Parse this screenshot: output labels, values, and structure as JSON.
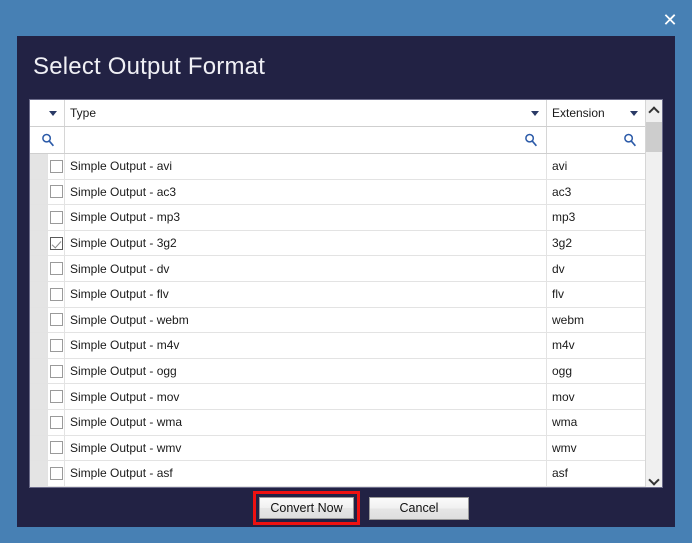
{
  "window": {
    "close_icon": "close-icon",
    "frame_color": "#4780b4",
    "dialog_color": "#222244"
  },
  "dialog": {
    "title": "Select Output Format"
  },
  "grid": {
    "columns": [
      {
        "key": "check",
        "label": "",
        "has_filter_arrow": true,
        "has_search": true
      },
      {
        "key": "type",
        "label": "Type",
        "has_filter_arrow": true,
        "has_search": true
      },
      {
        "key": "ext",
        "label": "Extension",
        "has_filter_arrow": true,
        "has_search": true
      }
    ],
    "search_icon": "search-icon",
    "rows": [
      {
        "checked": false,
        "type": "Simple Output - avi",
        "ext": "avi"
      },
      {
        "checked": false,
        "type": "Simple Output - ac3",
        "ext": "ac3"
      },
      {
        "checked": false,
        "type": "Simple Output - mp3",
        "ext": "mp3"
      },
      {
        "checked": true,
        "type": "Simple Output - 3g2",
        "ext": "3g2"
      },
      {
        "checked": false,
        "type": "Simple Output - dv",
        "ext": "dv"
      },
      {
        "checked": false,
        "type": "Simple Output - flv",
        "ext": "flv"
      },
      {
        "checked": false,
        "type": "Simple Output - webm",
        "ext": "webm"
      },
      {
        "checked": false,
        "type": "Simple Output - m4v",
        "ext": "m4v"
      },
      {
        "checked": false,
        "type": "Simple Output - ogg",
        "ext": "ogg"
      },
      {
        "checked": false,
        "type": "Simple Output - mov",
        "ext": "mov"
      },
      {
        "checked": false,
        "type": "Simple Output - wma",
        "ext": "wma"
      },
      {
        "checked": false,
        "type": "Simple Output - wmv",
        "ext": "wmv"
      },
      {
        "checked": false,
        "type": "Simple Output - asf",
        "ext": "asf"
      },
      {
        "checked": false,
        "type": "",
        "ext": ""
      }
    ],
    "scrollbar": {
      "up_icon": "chevron-up-icon",
      "down_icon": "chevron-down-icon",
      "thumb_position_pct": 6
    }
  },
  "footer": {
    "convert_label": "Convert Now",
    "cancel_label": "Cancel",
    "highlight_color": "#ee1111"
  }
}
